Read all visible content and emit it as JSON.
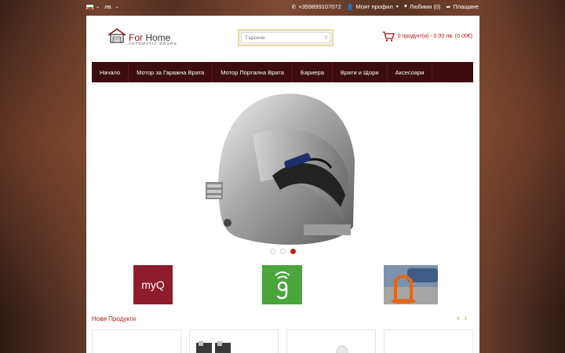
{
  "topbar": {
    "currency": "лв.",
    "phone": "+359899107072",
    "account": "Моят профил",
    "wishlist": "Любими (0)",
    "checkout": "Плащане"
  },
  "header": {
    "logo_for": "For",
    "logo_home": "Home",
    "logo_tagline": "AUTOMATIC DOORS",
    "search_placeholder": "Търсене",
    "cart_text": "0 продукт(и) - 0.00 лв. (0.00€)"
  },
  "nav": {
    "items": [
      {
        "label": "Начало"
      },
      {
        "label": "Мотор за Гаражна Врата"
      },
      {
        "label": "Мотор Портална Врата"
      },
      {
        "label": "Бариера"
      },
      {
        "label": "Врати и Щори"
      },
      {
        "label": "Аксесоари"
      }
    ]
  },
  "slider": {
    "slide_count": 3,
    "active_slide": 3
  },
  "brands": {
    "items": [
      {
        "label": "myQ"
      },
      {
        "label": "g"
      },
      {
        "label": ""
      }
    ]
  },
  "sections": {
    "new_products": "Нови Продукти"
  },
  "colors": {
    "nav_bg": "#3b0d10",
    "accent": "#b01818",
    "arrow": "#c49a3a"
  }
}
